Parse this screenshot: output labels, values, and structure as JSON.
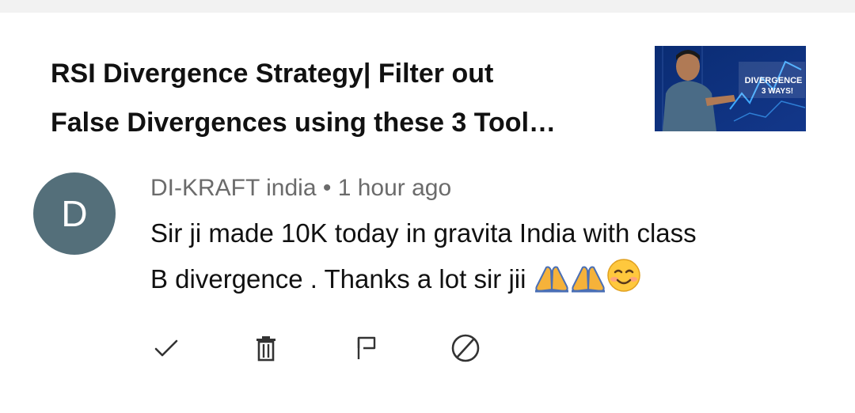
{
  "video": {
    "title_line1": "RSI Divergence Strategy| Filter out",
    "title_line2": "False Divergences using these 3 Tool…",
    "thumbnail": {
      "overlay_line1": "DIVERGENCE",
      "overlay_line2": "3 WAYS!"
    }
  },
  "comment": {
    "avatar_letter": "D",
    "author": "DI-KRAFT india",
    "separator": "•",
    "time": "1 hour ago",
    "text_line1": "Sir ji made 10K today in gravita India with class",
    "text_line2": "B divergence . Thanks a lot sir jii",
    "emojis": [
      "folded-hands",
      "folded-hands",
      "smiling-face"
    ]
  },
  "actions": [
    {
      "name": "approve",
      "icon": "check-icon"
    },
    {
      "name": "delete",
      "icon": "trash-icon"
    },
    {
      "name": "report",
      "icon": "flag-icon"
    },
    {
      "name": "block",
      "icon": "block-icon"
    }
  ],
  "colors": {
    "avatar_bg": "#546f7a",
    "meta_text": "#6b6b6b",
    "primary_text": "#111111"
  }
}
